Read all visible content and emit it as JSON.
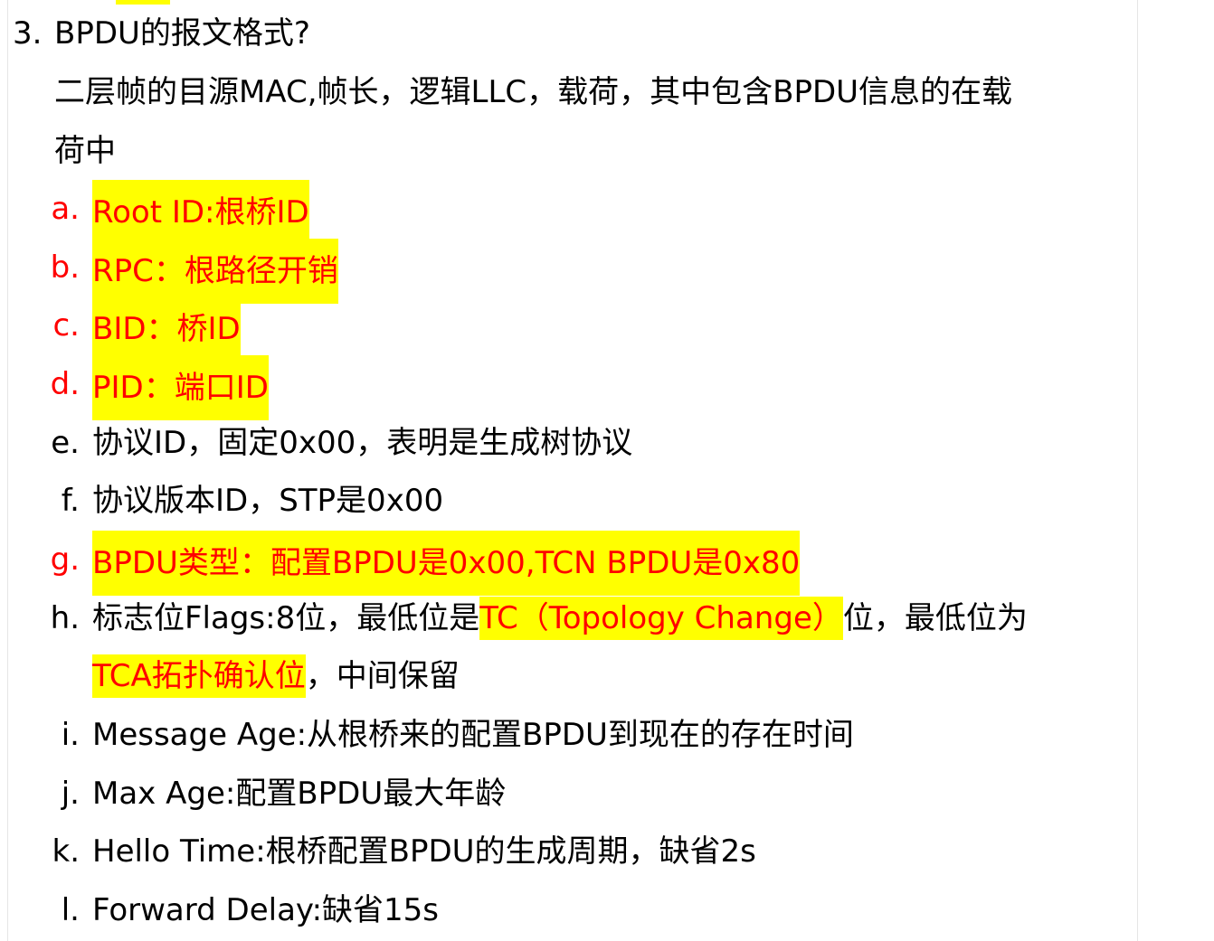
{
  "heading": {
    "number": "3.",
    "text": "BPDU的报文格式?"
  },
  "intro": {
    "line1": "二层帧的目源MAC,帧长，逻辑LLC，载荷，其中包含BPDU信息的在载",
    "line2": "荷中"
  },
  "items": [
    {
      "marker": "a.",
      "text": "Root ID:根桥ID"
    },
    {
      "marker": "b.",
      "text": "RPC：根路径开销"
    },
    {
      "marker": "c.",
      "text": "BID：桥ID"
    },
    {
      "marker": "d.",
      "text": "PID：端口ID"
    },
    {
      "marker": "e.",
      "text": "协议ID，固定0x00，表明是生成树协议"
    },
    {
      "marker": "f.",
      "text": "协议版本ID，STP是0x00"
    },
    {
      "marker": "g.",
      "text": "BPDU类型：配置BPDU是0x00,TCN BPDU是0x80"
    },
    {
      "marker": "h.",
      "part1": "标志位Flags:8位，最低位是",
      "part2": "TC（Topology Change）",
      "part3": "位，最低位为",
      "part4": "TCA拓扑确认位",
      "part5": "，中间保留"
    },
    {
      "marker": "i.",
      "text": "Message Age:从根桥来的配置BPDU到现在的存在时间"
    },
    {
      "marker": "j.",
      "text": "Max Age:配置BPDU最大年龄"
    },
    {
      "marker": "k.",
      "text": "Hello Time:根桥配置BPDU的生成周期，缺省2s"
    },
    {
      "marker": "l.",
      "text": "Forward Delay:缺省15s"
    }
  ],
  "colors": {
    "highlight": "#ffff00",
    "emphasis_text": "#ff0000",
    "body_text": "#000000"
  }
}
